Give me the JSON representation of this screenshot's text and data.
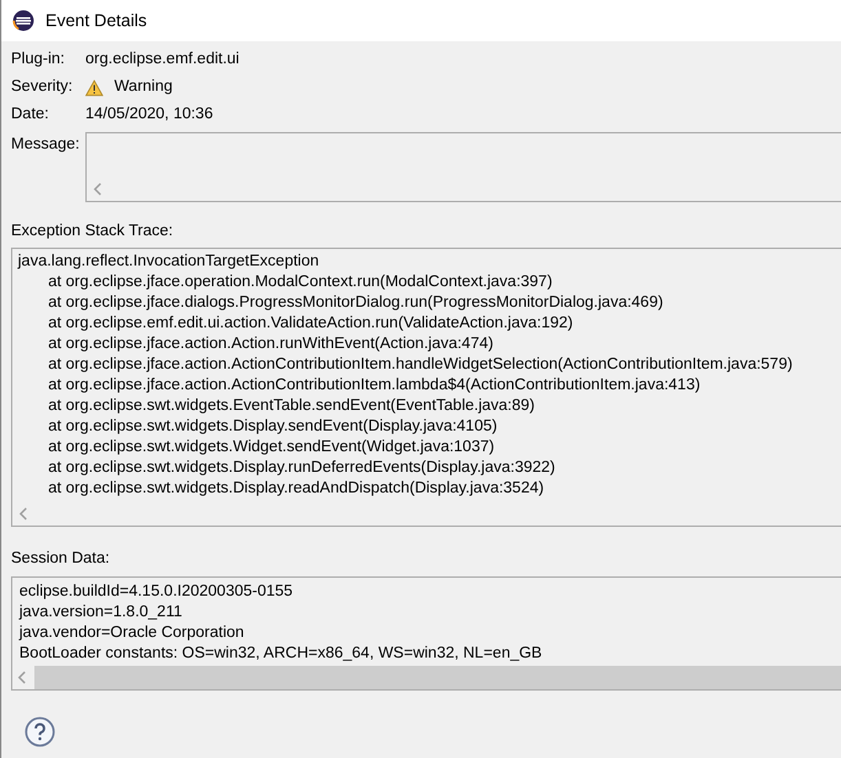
{
  "window": {
    "title": "Event Details"
  },
  "fields": [
    {
      "kind": "text",
      "label": "Plug-in:",
      "value": "org.eclipse.emf.edit.ui"
    },
    {
      "kind": "severity",
      "label": "Severity:",
      "value": "Warning"
    },
    {
      "kind": "text",
      "label": "Date:",
      "value": "14/05/2020, 10:36"
    },
    {
      "kind": "message",
      "label": "Message:"
    }
  ],
  "stack_trace": {
    "label": "Exception Stack Trace:",
    "lines": [
      {
        "text": "java.lang.reflect.InvocationTargetException",
        "children": [
          {
            "text": "at org.eclipse.jface.operation.ModalContext.run(ModalContext.java:397)"
          },
          {
            "text": "at org.eclipse.jface.dialogs.ProgressMonitorDialog.run(ProgressMonitorDialog.java:469)"
          },
          {
            "text": "at org.eclipse.emf.edit.ui.action.ValidateAction.run(ValidateAction.java:192)"
          },
          {
            "text": "at org.eclipse.jface.action.Action.runWithEvent(Action.java:474)"
          },
          {
            "text": "at org.eclipse.jface.action.ActionContributionItem.handleWidgetSelection(ActionContributionItem.java:579)"
          },
          {
            "text": "at org.eclipse.jface.action.ActionContributionItem.lambda$4(ActionContributionItem.java:413)"
          },
          {
            "text": "at org.eclipse.swt.widgets.EventTable.sendEvent(EventTable.java:89)"
          },
          {
            "text": "at org.eclipse.swt.widgets.Display.sendEvent(Display.java:4105)"
          },
          {
            "text": "at org.eclipse.swt.widgets.Widget.sendEvent(Widget.java:1037)"
          },
          {
            "text": "at org.eclipse.swt.widgets.Display.runDeferredEvents(Display.java:3922)"
          },
          {
            "text": "at org.eclipse.swt.widgets.Display.readAndDispatch(Display.java:3524)"
          }
        ]
      }
    ]
  },
  "session_data": {
    "label": "Session Data:",
    "lines": [
      "eclipse.buildId=4.15.0.I20200305-0155",
      "java.version=1.8.0_211",
      "java.vendor=Oracle Corporation",
      "BootLoader constants: OS=win32, ARCH=x86_64, WS=win32, NL=en_GB"
    ]
  }
}
